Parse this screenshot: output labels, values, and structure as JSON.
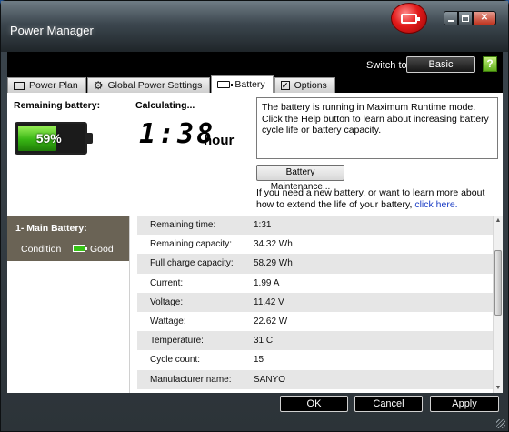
{
  "window": {
    "title": "Power Manager"
  },
  "header": {
    "switch_to_label": "Switch to:",
    "switch_to_button": "Basic",
    "help_glyph": "?"
  },
  "tabs": [
    {
      "label": "Power Plan",
      "icon": "power-plan-icon"
    },
    {
      "label": "Global Power Settings",
      "icon": "gear-icon"
    },
    {
      "label": "Battery",
      "icon": "battery-icon",
      "active": true
    },
    {
      "label": "Options",
      "icon": "checkbox-icon"
    }
  ],
  "battery_summary": {
    "remaining_label": "Remaining battery:",
    "percent_text": "59%",
    "percent_value": 59,
    "calculating_label": "Calculating...",
    "time_value": "1:38",
    "time_unit": "hour"
  },
  "info": {
    "message": "The battery is running in Maximum Runtime mode. Click the Help button to learn about increasing battery cycle life or battery capacity.",
    "maintenance_button": "Battery Maintenance...",
    "new_battery_text": "If you need a new battery, or want to learn more about how to extend the life of your battery,",
    "new_battery_link": "click here."
  },
  "battery_list": {
    "title": "1- Main Battery:",
    "condition_label": "Condition",
    "condition_value": "Good"
  },
  "details": [
    {
      "key": "Remaining time:",
      "value": "1:31"
    },
    {
      "key": "Remaining capacity:",
      "value": "34.32 Wh"
    },
    {
      "key": "Full charge capacity:",
      "value": "58.29 Wh"
    },
    {
      "key": "Current:",
      "value": "1.99 A"
    },
    {
      "key": "Voltage:",
      "value": "11.42 V"
    },
    {
      "key": "Wattage:",
      "value": "22.62 W"
    },
    {
      "key": "Temperature:",
      "value": "31 C"
    },
    {
      "key": "Cycle count:",
      "value": "15"
    },
    {
      "key": "Manufacturer name:",
      "value": "SANYO"
    }
  ],
  "footer": {
    "ok": "OK",
    "cancel": "Cancel",
    "apply": "Apply"
  },
  "colors": {
    "battery_green": "#38b614",
    "link_blue": "#1a3cc4",
    "sidebar_header": "#6a6355"
  }
}
